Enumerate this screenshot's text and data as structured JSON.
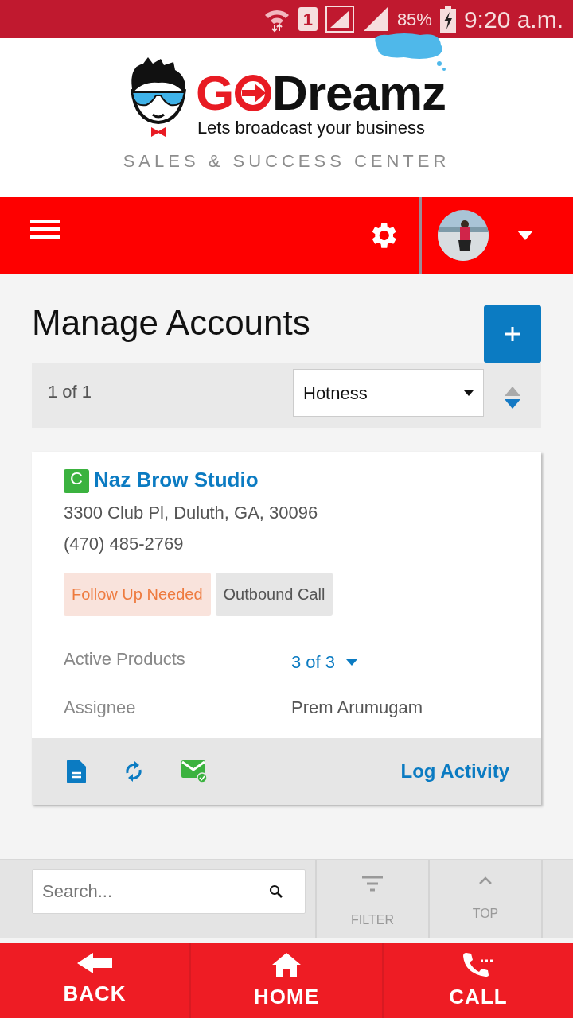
{
  "status_bar": {
    "sim": "1",
    "battery": "85%",
    "time": "9:20 a.m."
  },
  "logo": {
    "lead": "G",
    "rest": "Dreamz",
    "tagline": "Lets broadcast your business"
  },
  "subtitle": "SALES & SUCCESS CENTER",
  "page_title": "Manage Accounts",
  "pager": "1 of 1",
  "sort": {
    "value": "Hotness",
    "descending": true
  },
  "accounts": [
    {
      "badge": "C",
      "name": "Naz Brow Studio",
      "address": "3300 Club Pl, Duluth, GA, 30096",
      "phone": "(470) 485-2769",
      "tags": [
        {
          "label": "Follow Up Needed",
          "kind": "alert"
        },
        {
          "label": "Outbound Call",
          "kind": "plain"
        }
      ],
      "fields": [
        {
          "label": "Active Products",
          "value": "3 of 3",
          "kind": "dropdown"
        },
        {
          "label": "Assignee",
          "value": "Prem Arumugam",
          "kind": "text"
        }
      ],
      "action": "Log Activity"
    }
  ],
  "search": {
    "placeholder": "Search..."
  },
  "tools": [
    {
      "label": "FILTER",
      "kind": "filter"
    },
    {
      "label": "TOP",
      "kind": "top"
    }
  ],
  "nav": [
    {
      "label": "BACK",
      "kind": "back"
    },
    {
      "label": "HOME",
      "kind": "home"
    },
    {
      "label": "CALL",
      "kind": "call"
    }
  ]
}
